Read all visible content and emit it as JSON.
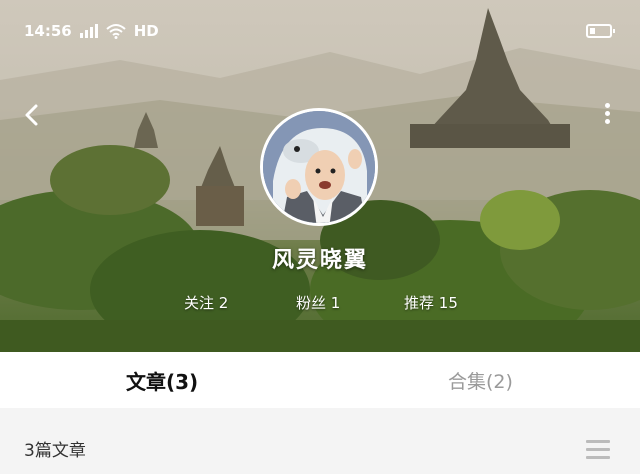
{
  "status_bar": {
    "time": "14:56",
    "network": "HD",
    "battery_level": 0.3
  },
  "profile": {
    "name": "风灵晓翼"
  },
  "stats": [
    {
      "label": "关注",
      "value": "2"
    },
    {
      "label": "粉丝",
      "value": "1"
    },
    {
      "label": "推荐",
      "value": "15"
    }
  ],
  "tabs": [
    {
      "label": "文章(3)",
      "active": true
    },
    {
      "label": "合集(2)",
      "active": false
    }
  ],
  "list_header": {
    "count_text": "3篇文章"
  },
  "icons": [
    "signal-icon",
    "wifi-icon",
    "battery-icon",
    "back-arrow-icon",
    "more-vertical-icon",
    "menu-icon"
  ]
}
